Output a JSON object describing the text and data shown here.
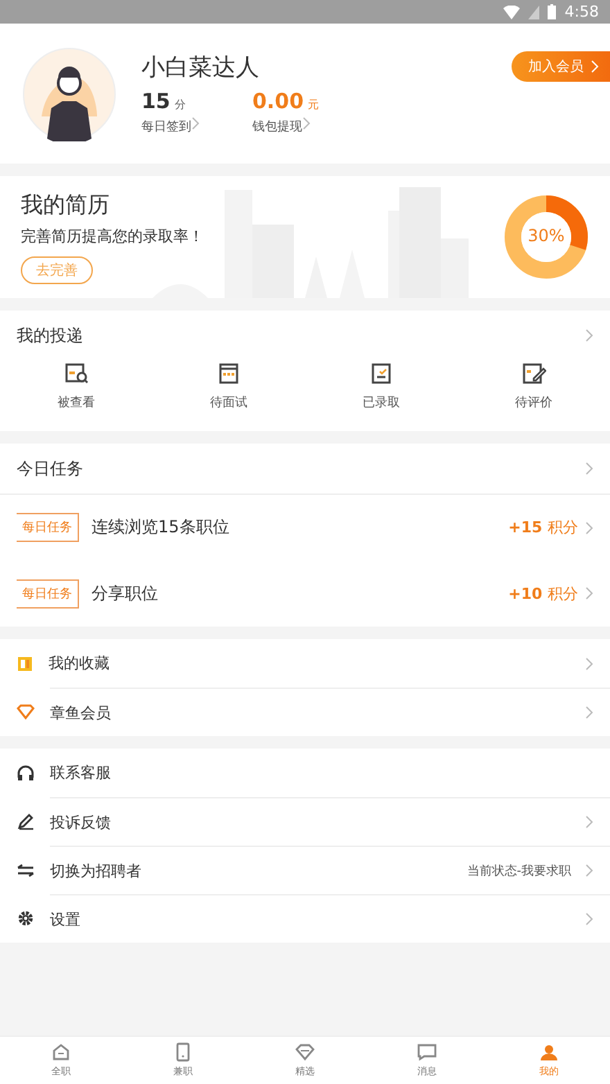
{
  "status_bar": {
    "time": "4:58"
  },
  "profile": {
    "name": "小白菜达人",
    "points": "15",
    "points_unit": "分",
    "points_label": "每日签到",
    "wallet": "0.00",
    "wallet_unit": "元",
    "wallet_label": "钱包提现",
    "vip_button": "加入会员"
  },
  "resume": {
    "title": "我的简历",
    "subtitle": "完善简历提高您的录取率！",
    "button": "去完善",
    "percent": "30%",
    "level": 0.3
  },
  "deliveries": {
    "title": "我的投递",
    "items": [
      {
        "label": "被查看",
        "kind": "viewed"
      },
      {
        "label": "待面试",
        "kind": "interview"
      },
      {
        "label": "已录取",
        "kind": "hired"
      },
      {
        "label": "待评价",
        "kind": "review"
      }
    ]
  },
  "tasks": {
    "title": "今日任务",
    "items": [
      {
        "tag": "每日任务",
        "name": "连续浏览15条职位",
        "reward": "+15",
        "reward_unit": "积分"
      },
      {
        "tag": "每日任务",
        "name": "分享职位",
        "reward": "+10",
        "reward_unit": "积分"
      }
    ]
  },
  "menu_groups": [
    [
      {
        "label": "我的收藏",
        "kind": "favorites",
        "chevron": true
      },
      {
        "label": "章鱼会员",
        "kind": "vip",
        "chevron": true
      }
    ],
    [
      {
        "label": "联系客服",
        "kind": "support",
        "chevron": false
      },
      {
        "label": "投诉反馈",
        "kind": "feedback",
        "chevron": true
      },
      {
        "label": "切换为招聘者",
        "kind": "switch",
        "value": "当前状态-我要求职",
        "chevron": true
      },
      {
        "label": "设置",
        "kind": "settings",
        "chevron": true
      }
    ]
  ],
  "tab_bar": [
    {
      "label": "全职",
      "kind": "home",
      "selected": false
    },
    {
      "label": "兼职",
      "kind": "phone",
      "selected": false
    },
    {
      "label": "精选",
      "kind": "diamond",
      "selected": false
    },
    {
      "label": "消息",
      "kind": "chat",
      "selected": false
    },
    {
      "label": "我的",
      "kind": "me",
      "selected": true
    }
  ]
}
